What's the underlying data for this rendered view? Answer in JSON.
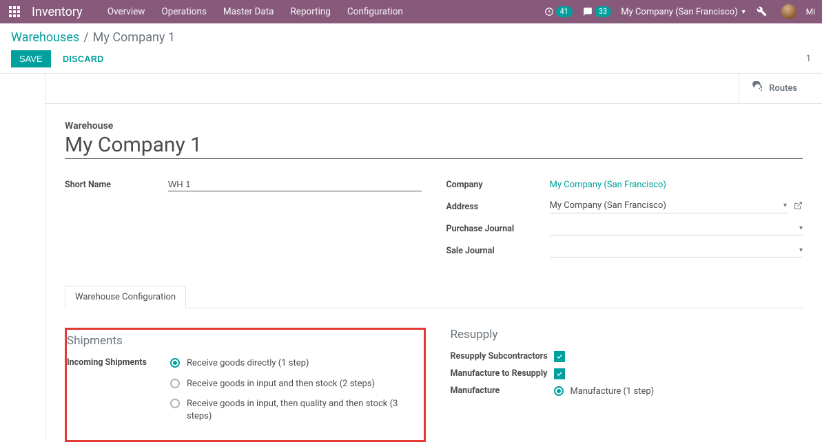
{
  "navbar": {
    "brand": "Inventory",
    "menu": [
      "Overview",
      "Operations",
      "Master Data",
      "Reporting",
      "Configuration"
    ],
    "clock_badge": "41",
    "chat_badge": "33",
    "company": "My Company (San Francisco)",
    "user_short": "Mi"
  },
  "breadcrumb": {
    "root": "Warehouses",
    "current": "My Company 1"
  },
  "buttons": {
    "save": "SAVE",
    "discard": "DISCARD",
    "routes": "Routes"
  },
  "counter": "1",
  "form": {
    "warehouse_label": "Warehouse",
    "name": "My Company 1",
    "short_name_label": "Short Name",
    "short_name": "WH 1",
    "company_label": "Company",
    "company_value": "My Company (San Francisco)",
    "address_label": "Address",
    "address_value": "My Company (San Francisco)",
    "purchase_journal_label": "Purchase Journal",
    "sale_journal_label": "Sale Journal"
  },
  "tab": {
    "label": "Warehouse Configuration"
  },
  "shipments": {
    "title": "Shipments",
    "incoming_label": "Incoming Shipments",
    "opts": [
      "Receive goods directly (1 step)",
      "Receive goods in input and then stock (2 steps)",
      "Receive goods in input, then quality and then stock (3 steps)"
    ]
  },
  "resupply": {
    "title": "Resupply",
    "subcon_label": "Resupply Subcontractors",
    "manuf2resupply_label": "Manufacture to Resupply",
    "manufacture_label": "Manufacture",
    "manufacture_opt": "Manufacture (1 step)"
  }
}
